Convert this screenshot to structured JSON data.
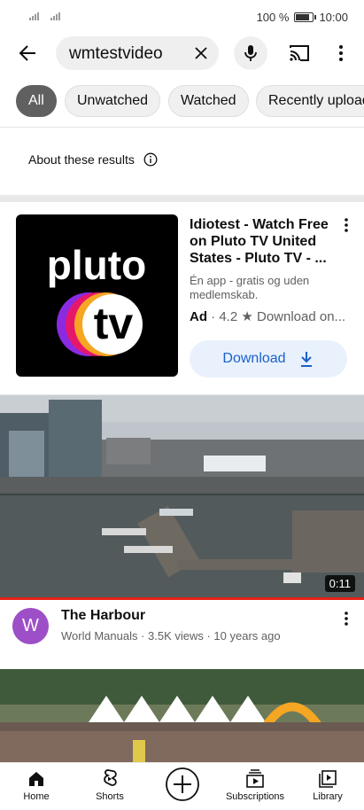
{
  "status_bar": {
    "battery": "100 %",
    "time": "10:00"
  },
  "search": {
    "query": "wmtestvideo"
  },
  "chips": [
    "All",
    "Unwatched",
    "Watched",
    "Recently uploaded"
  ],
  "about_results": "About these results",
  "ad": {
    "title": "Idiotest - Watch Free on Pluto TV United States - Pluto TV - ...",
    "description": "Én app - gratis og uden medlemskab.",
    "badge": "Ad",
    "rating": "4.2",
    "meta_suffix": "Download on...",
    "download_label": "Download",
    "logo_text_top": "pluto",
    "logo_text_bottom": "tv"
  },
  "video": {
    "title": "The Harbour",
    "channel_initial": "W",
    "meta": "World Manuals · 3.5K views · 10 years ago",
    "duration": "0:11"
  },
  "bottom_nav": {
    "home": "Home",
    "shorts": "Shorts",
    "subscriptions": "Subscriptions",
    "library": "Library"
  },
  "colors": {
    "accent_red": "#e62117",
    "download_blue": "#1a60c8",
    "avatar_purple": "#9c4fc7"
  }
}
